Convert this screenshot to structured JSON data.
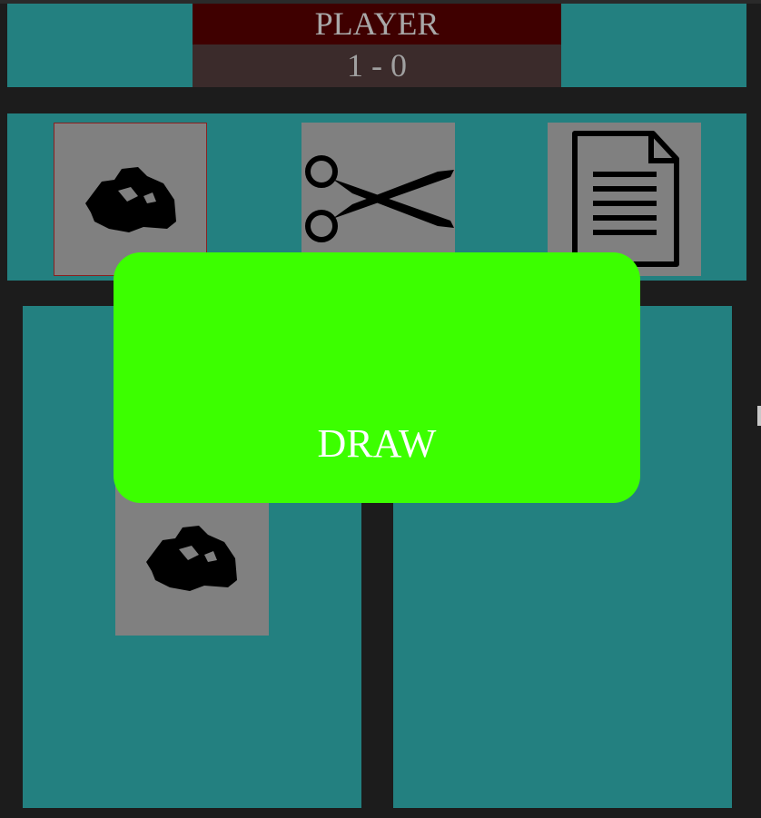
{
  "header": {
    "player_label": "PLAYER",
    "score": "1 - 0"
  },
  "choices": [
    {
      "name": "rock",
      "icon": "rock-icon",
      "selected": true
    },
    {
      "name": "scissors",
      "icon": "scissors-icon",
      "selected": false
    },
    {
      "name": "paper",
      "icon": "paper-icon",
      "selected": false
    }
  ],
  "arena": {
    "player_pick_icon": "rock-icon",
    "opponent_pick_icon": null
  },
  "result": {
    "text": "DRAW"
  },
  "colors": {
    "board": "#238080",
    "background": "#1c1c1c",
    "player_name_bg": "#3f0000",
    "score_bg": "#3b2b2b",
    "card": "#808080",
    "result_bg": "#3cff00"
  }
}
